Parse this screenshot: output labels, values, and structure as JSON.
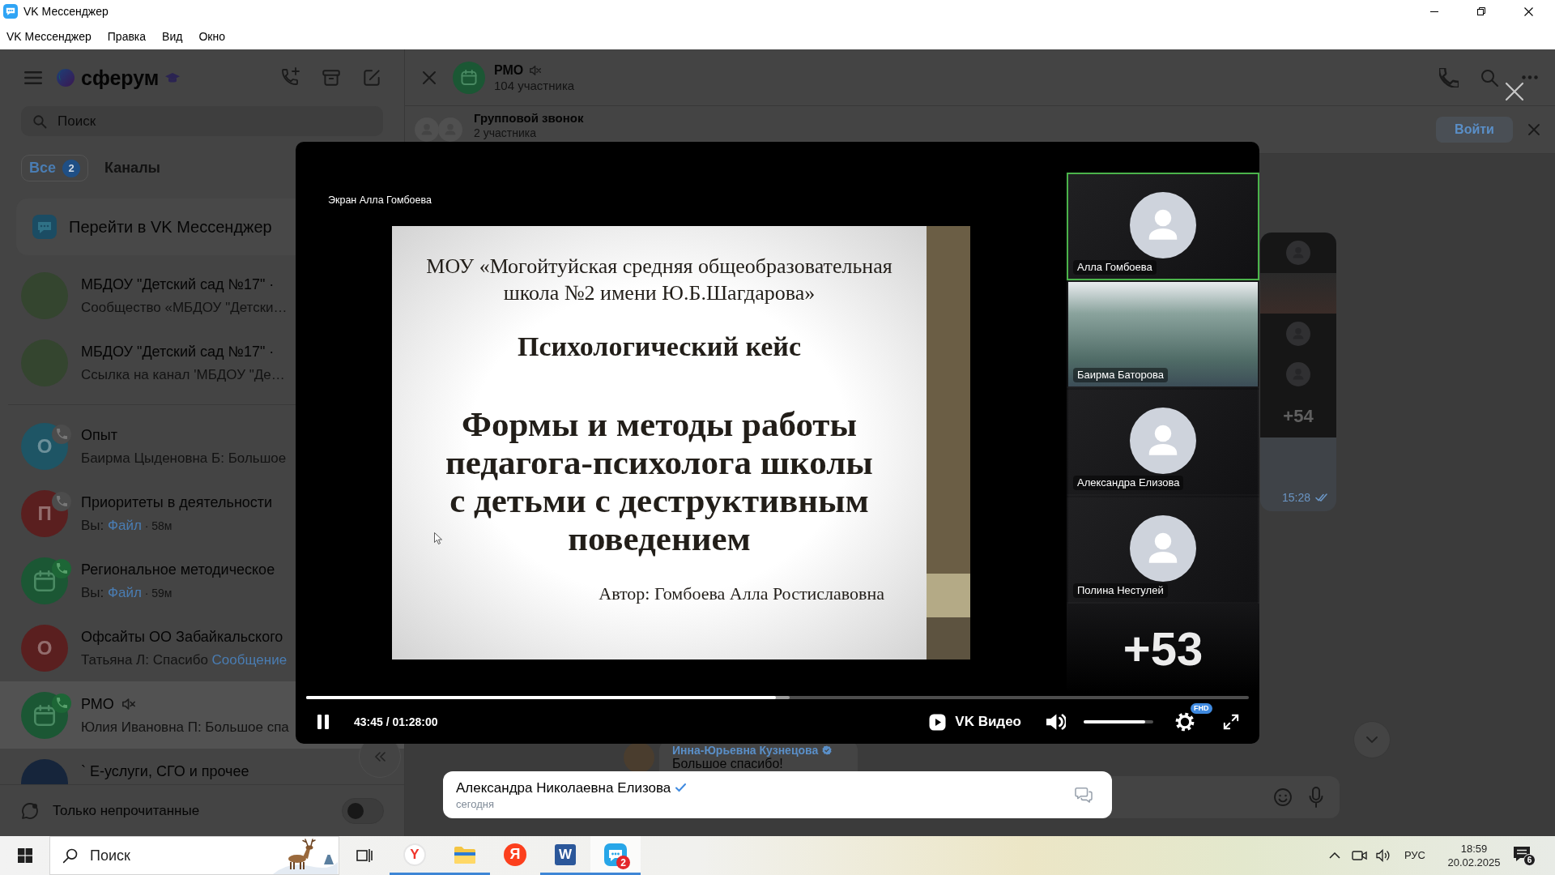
{
  "window": {
    "title": "VK Мессенджер"
  },
  "menu": [
    {
      "label": "VK Мессенджер"
    },
    {
      "label": "Правка"
    },
    {
      "label": "Вид"
    },
    {
      "label": "Окно"
    }
  ],
  "sidebar": {
    "logo": "сферум",
    "search": {
      "placeholder": "Поиск"
    },
    "tabs": [
      {
        "label": "Все",
        "badge": "2",
        "selected": true
      },
      {
        "label": "Каналы",
        "selected": false
      }
    ],
    "promo": {
      "label": "Перейти в VK Мессенджер"
    },
    "pinned": [
      {
        "title": "МБДОУ \"Детский сад №17\" ·",
        "preview": [
          {
            "kind": "text",
            "text": "Сообщество «МБДОУ \"Детски…"
          }
        ],
        "avatar": {
          "kind": "image",
          "color": "#34452f"
        },
        "muted": false,
        "selected": false
      },
      {
        "title": "МБДОУ \"Детский сад №17\" ·",
        "preview": [
          {
            "kind": "text",
            "text": "Ссылка на канал 'МБДОУ \"Де…"
          }
        ],
        "avatar": {
          "kind": "image",
          "color": "#34452f"
        },
        "muted": false,
        "selected": false
      }
    ],
    "chats": [
      {
        "title": "Опыт",
        "preview": [
          {
            "kind": "text",
            "text": "Баирма Цыденовна Б: Большое"
          }
        ],
        "avatar": {
          "kind": "letter",
          "letter": "О",
          "color": "#1e5565"
        },
        "call": {
          "active": false
        },
        "muted": false,
        "selected": false
      },
      {
        "title": "Приоритеты в деятельности",
        "preview": [
          {
            "kind": "text",
            "text": "Вы: "
          },
          {
            "kind": "link",
            "text": "Файл"
          },
          {
            "kind": "time",
            "text": " · 58м"
          }
        ],
        "avatar": {
          "kind": "letter",
          "letter": "П",
          "color": "#5a1f1f"
        },
        "call": {
          "active": false
        },
        "muted": false,
        "selected": false
      },
      {
        "title": "Региональное методическое",
        "preview": [
          {
            "kind": "text",
            "text": "Вы: "
          },
          {
            "kind": "link",
            "text": "Файл"
          },
          {
            "kind": "time",
            "text": " · 59м"
          }
        ],
        "avatar": {
          "kind": "calendar",
          "color": "#1b5734"
        },
        "call": {
          "active": true
        },
        "muted": false,
        "selected": false
      },
      {
        "title": "Офсайты ОО Забайкальского",
        "preview": [
          {
            "kind": "text",
            "text": "Татьяна Л: Спасибо "
          },
          {
            "kind": "link",
            "text": "Сообщение"
          }
        ],
        "avatar": {
          "kind": "letter",
          "letter": "О",
          "color": "#5a1f1f"
        },
        "muted": false,
        "selected": false
      },
      {
        "title": "РМО",
        "preview": [
          {
            "kind": "text",
            "text": "Юлия Ивановна П: Большое спа"
          }
        ],
        "avatar": {
          "kind": "calendar",
          "color": "#1b5734"
        },
        "call": {
          "active": true
        },
        "muted": true,
        "selected": true
      },
      {
        "title": "` Е-услуги, СГО и прочее",
        "avatar": {
          "kind": "image",
          "color": "#16253b"
        },
        "muted": false,
        "selected": false
      }
    ],
    "unread_only": {
      "label": "Только непрочитанные",
      "on": false
    }
  },
  "chat": {
    "title": "РМО",
    "muted": true,
    "subtitle": "104 участника",
    "group_call": {
      "title": "Групповой звонок",
      "subtitle": "2 участника",
      "button": "Войти"
    },
    "call_preview": {
      "tiles": [
        {
          "kind": "avatar"
        },
        {
          "kind": "video"
        },
        {
          "kind": "avatar"
        },
        {
          "kind": "avatar"
        }
      ],
      "more": "+54",
      "time": "15:28"
    },
    "message": {
      "author": "Инна-Юрьевна Кузнецова",
      "verified": true,
      "text": "Большое спасибо!"
    }
  },
  "viewer": {
    "screen_label": "Экран Алла Гомбоева",
    "slide": {
      "heading": [
        "МОУ «Могойтуйская средняя общеобразовательная",
        "школа №2 имени Ю.Б.Шагдарова»"
      ],
      "subtitle": "Психологический кейс",
      "title": [
        "Формы и методы работы",
        "педагога-психолога школы",
        "с детьми с деструктивным",
        "поведением"
      ],
      "author": "Автор: Гомбоева Алла Ростиславовна"
    },
    "participants": [
      {
        "name": "Алла Гомбоева",
        "kind": "avatar",
        "speaking": true
      },
      {
        "name": "Баирма Баторова",
        "kind": "video",
        "speaking": false
      },
      {
        "name": "Александра Елизова",
        "kind": "avatar",
        "speaking": false
      },
      {
        "name": "Полина Нестулей",
        "kind": "avatar",
        "speaking": false
      }
    ],
    "more": "+53",
    "playing": true,
    "progress": {
      "level": 0.498
    },
    "buffer": {
      "level": 0.513
    },
    "time": "43:45 / 01:28:00",
    "brand": "VK Видео",
    "volume": {
      "level": 0.88
    },
    "quality": "FHD"
  },
  "notification": {
    "name": "Александра Николаевна Елизова",
    "verified": true,
    "time": "сегодня"
  },
  "taskbar": {
    "search": {
      "placeholder": "Поиск"
    },
    "apps": [
      {
        "kind": "yandex-browser",
        "glyph": "Y",
        "running": true,
        "active": false
      },
      {
        "kind": "explorer",
        "running": true,
        "active": false
      },
      {
        "kind": "yandex",
        "glyph": "Я",
        "running": false,
        "active": false
      },
      {
        "kind": "word",
        "glyph": "W",
        "running": true,
        "active": false
      },
      {
        "kind": "messenger",
        "badge": "2",
        "running": true,
        "active": true
      }
    ],
    "tray": {
      "language": "РУС",
      "time": "18:59",
      "date": "20.02.2025",
      "notifications": "6"
    }
  }
}
